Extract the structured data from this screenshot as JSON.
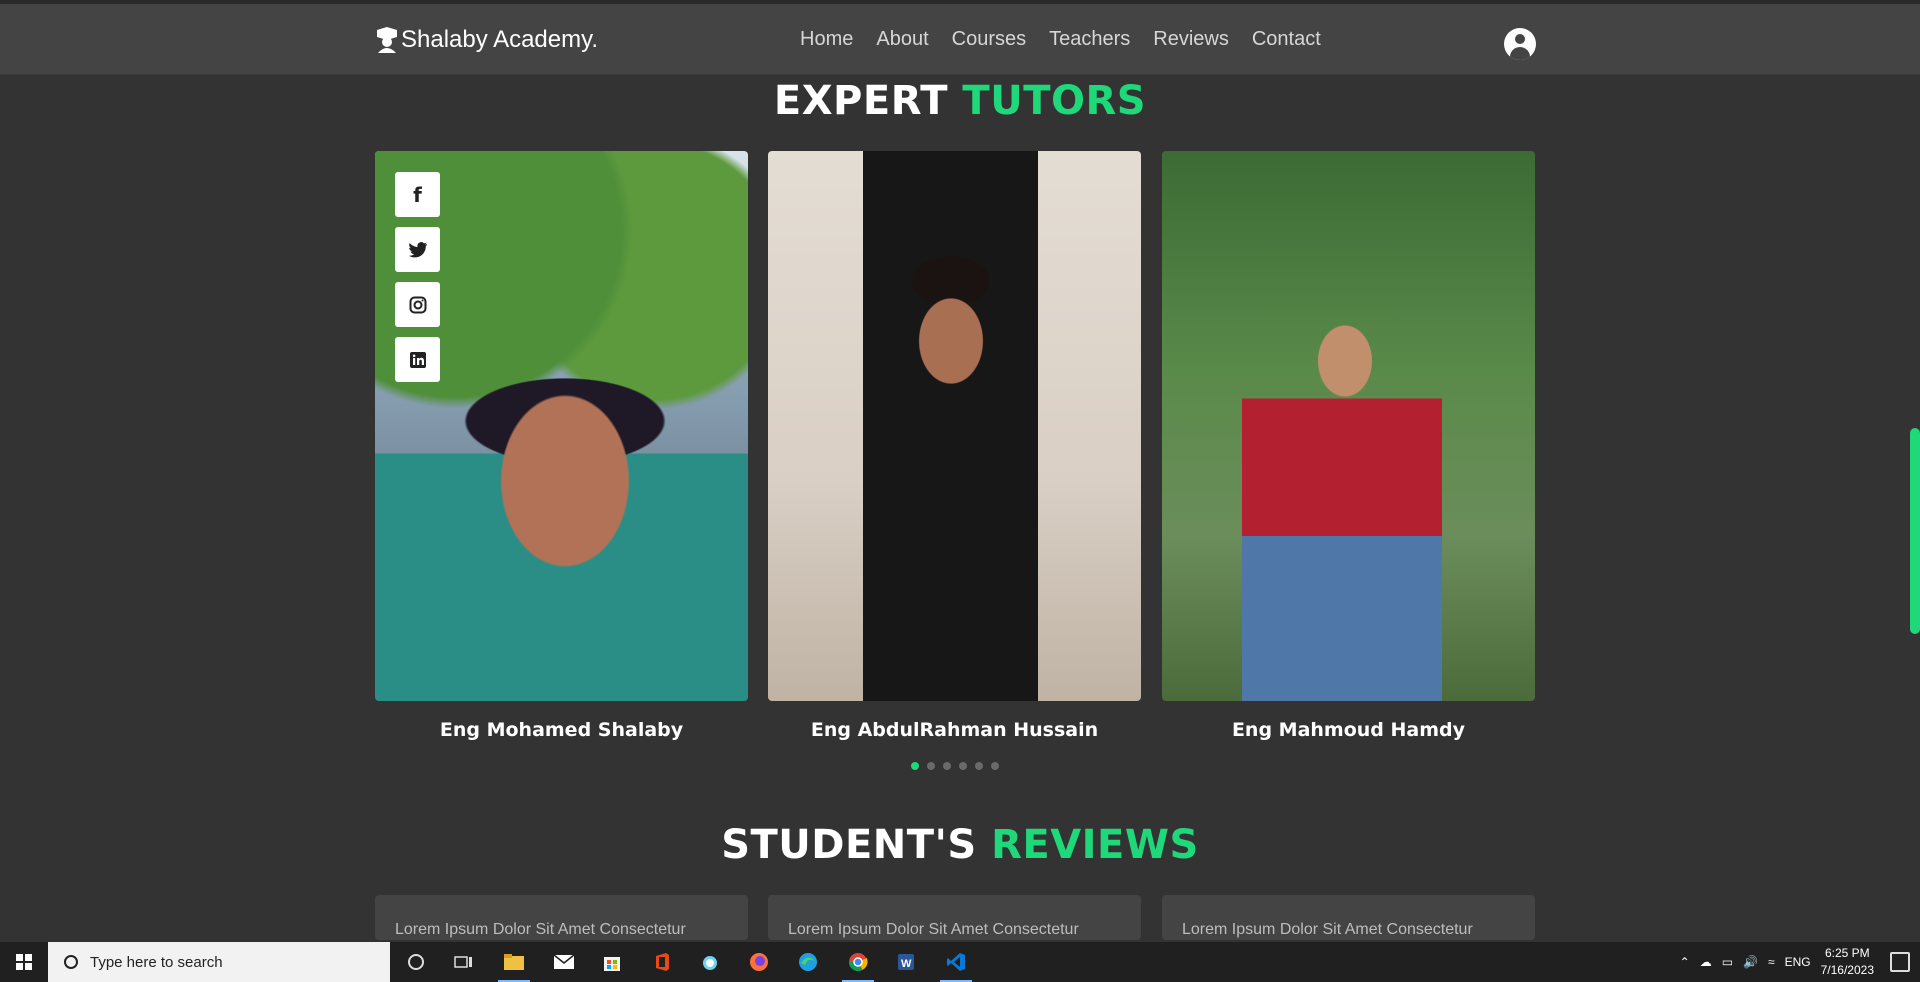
{
  "header": {
    "logo_text": "Shalaby Academy.",
    "nav": [
      "Home",
      "About",
      "Courses",
      "Teachers",
      "Reviews",
      "Contact"
    ]
  },
  "tutors_section": {
    "title_plain": "EXPERT",
    "title_accent": "TUTORS",
    "social_icons": [
      "facebook-icon",
      "twitter-icon",
      "instagram-icon",
      "linkedin-icon"
    ],
    "tutors": [
      {
        "name": "Eng Mohamed Shalaby"
      },
      {
        "name": "Eng AbdulRahman Hussain"
      },
      {
        "name": "Eng Mahmoud Hamdy"
      }
    ],
    "carousel_pages": 6,
    "carousel_active": 1
  },
  "reviews_section": {
    "title_plain": "STUDENT'S",
    "title_accent": "REVIEWS",
    "reviews": [
      {
        "text": "Lorem Ipsum Dolor Sit Amet Consectetur"
      },
      {
        "text": "Lorem Ipsum Dolor Sit Amet Consectetur"
      },
      {
        "text": "Lorem Ipsum Dolor Sit Amet Consectetur"
      }
    ]
  },
  "colors": {
    "accent": "#1ed87a",
    "background": "#333333",
    "header": "#444444"
  },
  "taskbar": {
    "search_placeholder": "Type here to search",
    "language": "ENG",
    "time": "6:25 PM",
    "date": "7/16/2023"
  }
}
